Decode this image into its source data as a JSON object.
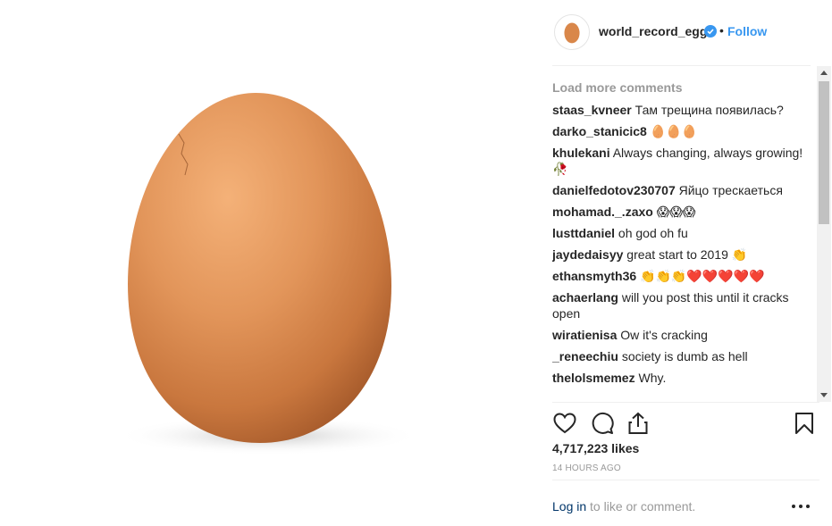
{
  "post": {
    "username": "world_record_egg",
    "separator": "•",
    "follow_label": "Follow"
  },
  "comments": {
    "load_more": "Load more comments",
    "items": [
      {
        "user": "staas_kvneer",
        "text": "Там трещина появилась?"
      },
      {
        "user": "darko_stanicic8",
        "text": "🥚🥚🥚"
      },
      {
        "user": "khulekani",
        "text": "Always changing, always growing! 🥀"
      },
      {
        "user": "danielfedotov230707",
        "text": "Яйцо трескаеться"
      },
      {
        "user": "mohamad._.zaxo",
        "text": "😱😱😱"
      },
      {
        "user": "lusttdaniel",
        "text": "oh god oh fu"
      },
      {
        "user": "jaydedaisyy",
        "text": "great start to 2019 👏"
      },
      {
        "user": "ethansmyth36",
        "text": "👏👏👏❤️❤️❤️❤️❤️"
      },
      {
        "user": "achaerlang",
        "text": "will you post this until it cracks open"
      },
      {
        "user": "wiratienisa",
        "text": "Ow it's cracking"
      },
      {
        "user": "_reneechiu",
        "text": "society is dumb as hell"
      },
      {
        "user": "thelolsmemez",
        "text": "Why."
      }
    ]
  },
  "stats": {
    "likes": "4,717,223 likes",
    "time": "14 HOURS AGO"
  },
  "footer": {
    "login_link": "Log in",
    "login_suffix": " to like or comment."
  },
  "colors": {
    "accent": "#3897f0",
    "muted": "#999999",
    "link": "#003569",
    "egg": "#d9874a"
  },
  "icons": {
    "like": "heart-icon",
    "comment": "speech-bubble-icon",
    "share": "share-icon",
    "save": "bookmark-icon",
    "verified": "verified-badge-icon",
    "more": "ellipsis-icon"
  }
}
